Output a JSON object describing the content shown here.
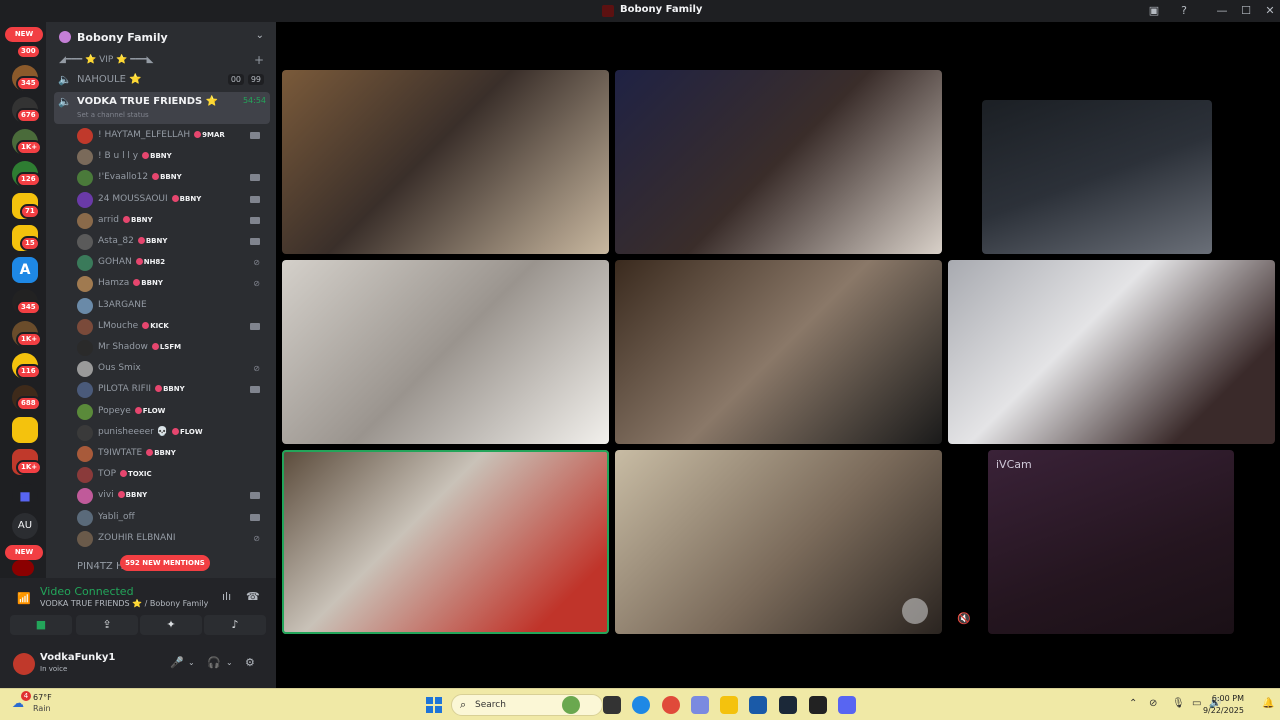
{
  "window": {
    "title": "Bobony Family"
  },
  "rail": {
    "new_top": "NEW",
    "new_bottom": "NEW",
    "badges": [
      "300",
      "345",
      "676",
      "1K+",
      "126",
      "71",
      "15",
      "345",
      "1K+",
      "116",
      "688",
      "1K+"
    ],
    "au_label": "AU"
  },
  "server": {
    "name": "Bobony Family"
  },
  "category": {
    "label": "◢━━━ ⭐ VIP ⭐ ━━━◣"
  },
  "channels": [
    {
      "name": "NAHOULE ⭐",
      "counts": [
        "00",
        "99"
      ]
    },
    {
      "name": "VODKA TRUE FRIENDS ⭐",
      "timer": "54:54",
      "status": "Set a channel status"
    }
  ],
  "members": [
    {
      "name": "! HAYTAM_ELFELLAH",
      "tag": "9MAR",
      "indicator": "camera"
    },
    {
      "name": "! B u l l y",
      "tag": "BBNY",
      "indicator": ""
    },
    {
      "name": "!'Evaallo12",
      "tag": "BBNY",
      "indicator": "camera"
    },
    {
      "name": "24 MOUSSAOUI",
      "tag": "BBNY",
      "indicator": "camera"
    },
    {
      "name": "arrid",
      "tag": "BBNY",
      "indicator": "camera"
    },
    {
      "name": "Asta_82",
      "tag": "BBNY",
      "indicator": "camera"
    },
    {
      "name": "GOHAN",
      "tag": "NH82",
      "indicator": "deafened"
    },
    {
      "name": "Hamza",
      "tag": "BBNY",
      "indicator": "deafened"
    },
    {
      "name": "L3ARGANE",
      "tag": "",
      "indicator": ""
    },
    {
      "name": "LMouche",
      "tag": "KICK",
      "indicator": "camera"
    },
    {
      "name": "Mr Shadow",
      "tag": "LSFM",
      "indicator": ""
    },
    {
      "name": "Ous Smix",
      "tag": "",
      "indicator": "deafened"
    },
    {
      "name": "PILOTA RIFII",
      "tag": "BBNY",
      "indicator": "camera"
    },
    {
      "name": "Popeye",
      "tag": "FLOW",
      "indicator": ""
    },
    {
      "name": "punisheeeer 💀",
      "tag": "FLOW",
      "indicator": ""
    },
    {
      "name": "T9IWTATE",
      "tag": "BBNY",
      "indicator": ""
    },
    {
      "name": "TOP",
      "tag": "TOXIC",
      "indicator": ""
    },
    {
      "name": "vivi",
      "tag": "BBNY",
      "indicator": "camera"
    },
    {
      "name": "Yabli_off",
      "tag": "",
      "indicator": "camera"
    },
    {
      "name": "ZOUHIR ELBNANI",
      "tag": "",
      "indicator": "deafened"
    }
  ],
  "mentions": "592 NEW MENTIONS",
  "partial_channel": "PIN4TZ H",
  "voice": {
    "status": "Video Connected",
    "location": "VODKA TRUE FRIENDS ⭐ / Bobony Family"
  },
  "me": {
    "name": "VodkaFunky1",
    "status": "In voice"
  },
  "video": {
    "ivcam_label": "iVCam"
  },
  "taskbar": {
    "temp": "67°F",
    "weather": "Rain",
    "weather_badge": "4",
    "search_placeholder": "Search",
    "time": "6:00 PM",
    "date": "9/22/2025"
  },
  "colors": {
    "accent_green": "#23a55a",
    "red": "#f23f43",
    "sidebar": "#2b2d31"
  }
}
